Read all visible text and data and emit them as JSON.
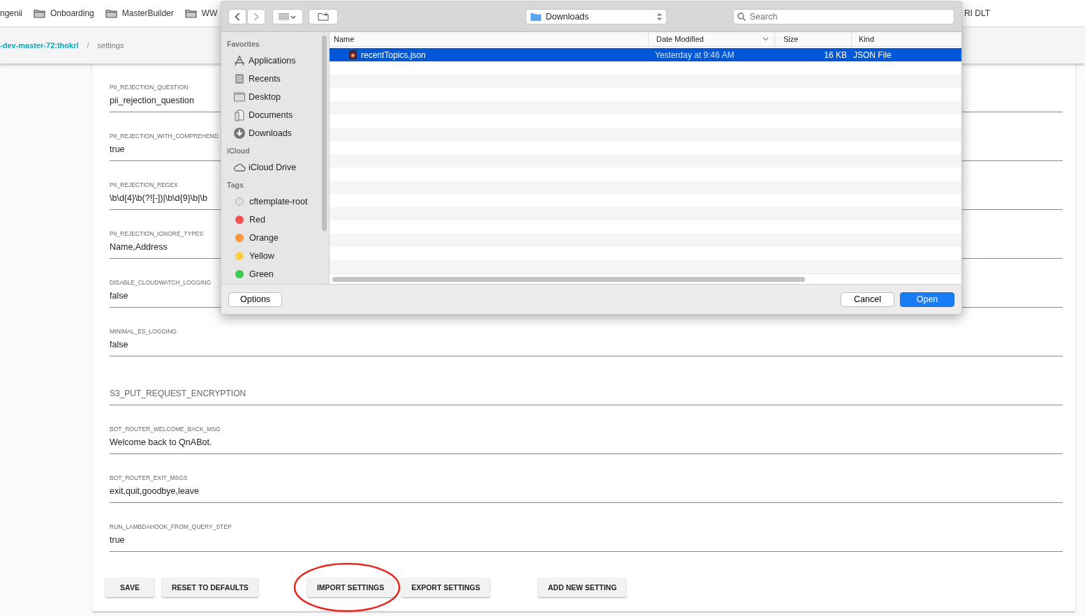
{
  "bookmarks": [
    {
      "label": "ngenii",
      "kind": "plain"
    },
    {
      "label": "Onboarding",
      "kind": "folder"
    },
    {
      "label": "MasterBuilder",
      "kind": "folder"
    },
    {
      "label": "WW",
      "kind": "folder"
    },
    {
      "label": "RI DLT",
      "kind": "plain"
    }
  ],
  "breadcrumb": {
    "items": [
      "-dev-master-72:thokrl",
      "settings"
    ],
    "separator": "/"
  },
  "settings": [
    {
      "label": "PII_REJECTION_QUESTION",
      "value": "pii_rejection_question"
    },
    {
      "label": "PII_REJECTION_WITH_COMPREHEND",
      "value": "true"
    },
    {
      "label": "PII_REJECTION_REGEX",
      "value": "\\b\\d{4}\\b(?![-])|\\b\\d{9}\\b|\\b"
    },
    {
      "label": "PII_REJECTION_IGNORE_TYPES",
      "value": "Name,Address"
    },
    {
      "label": "DISABLE_CLOUDWATCH_LOGGING",
      "value": "false"
    },
    {
      "label": "MINIMAL_ES_LOGGING",
      "value": "false"
    },
    {
      "placeholder": "S3_PUT_REQUEST_ENCRYPTION"
    },
    {
      "label": "BOT_ROUTER_WELCOME_BACK_MSG",
      "value": "Welcome back to QnABot."
    },
    {
      "label": "BOT_ROUTER_EXIT_MSGS",
      "value": "exit,quit,goodbye,leave"
    },
    {
      "label": "RUN_LAMBDAHOOK_FROM_QUERY_STEP",
      "value": "true"
    }
  ],
  "buttons": [
    {
      "label": "SAVE",
      "circled": false
    },
    {
      "label": "RESET TO DEFAULTS",
      "circled": false
    },
    {
      "label": "IMPORT SETTINGS",
      "circled": true
    },
    {
      "label": "EXPORT SETTINGS",
      "circled": false
    },
    {
      "label": "ADD NEW SETTING",
      "circled": false
    }
  ],
  "dialog": {
    "location": "Downloads",
    "search": {
      "placeholder": "Search"
    },
    "sidebar": [
      {
        "heading": "Favorites",
        "items": [
          {
            "label": "Applications",
            "kind": "applications"
          },
          {
            "label": "Recents",
            "kind": "recents"
          },
          {
            "label": "Desktop",
            "kind": "desktop"
          },
          {
            "label": "Documents",
            "kind": "documents"
          },
          {
            "label": "Downloads",
            "kind": "downloads"
          }
        ]
      },
      {
        "heading": "iCloud",
        "items": [
          {
            "label": "iCloud Drive",
            "kind": "cloud"
          }
        ]
      },
      {
        "heading": "Tags",
        "items": [
          {
            "label": "cftemplate-root",
            "kind": "tag",
            "color": "#e0e0e0"
          },
          {
            "label": "Red",
            "kind": "tag",
            "color": "#fc4f4f"
          },
          {
            "label": "Orange",
            "kind": "tag",
            "color": "#fd963c"
          },
          {
            "label": "Yellow",
            "kind": "tag",
            "color": "#fdcd44"
          },
          {
            "label": "Green",
            "kind": "tag",
            "color": "#3fc950"
          }
        ]
      }
    ],
    "columns": [
      {
        "label": "Name",
        "sorted": false
      },
      {
        "label": "Date Modified",
        "sorted": true
      },
      {
        "label": "Size",
        "sorted": false
      },
      {
        "label": "Kind",
        "sorted": false
      }
    ],
    "files": [
      {
        "name": "recentTopics.json",
        "date": "Yesterday at 9:46 AM",
        "size": "16 KB",
        "kind": "JSON File",
        "selected": true
      }
    ],
    "buttons": {
      "options": "Options",
      "cancel": "Cancel",
      "open": "Open"
    }
  }
}
